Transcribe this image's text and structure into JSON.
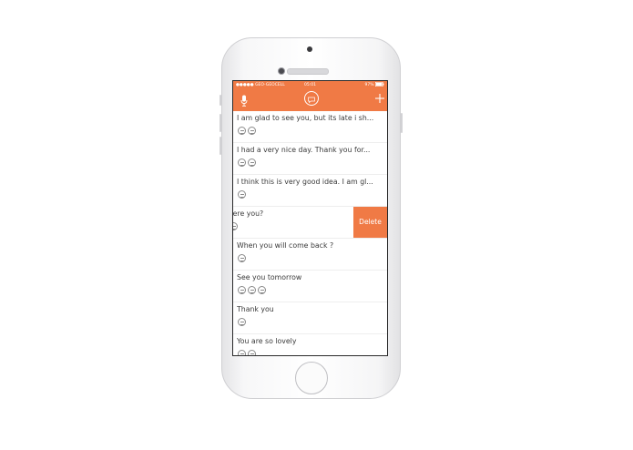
{
  "status_bar": {
    "carrier": "●●●●● GEO-GEOCELL",
    "time": "05:01",
    "battery": "97%"
  },
  "nav": {
    "left_icon": "microphone-icon",
    "center_icon": "app-logo-icon",
    "right_icon": "plus-icon"
  },
  "colors": {
    "accent": "#f07a45",
    "text": "#3a3a3a",
    "icon": "#8a8a8a"
  },
  "messages": [
    {
      "text": "I am glad to see you, but its late i sh...",
      "icon_count": 2
    },
    {
      "text": "I had a very nice day. Thank you for...",
      "icon_count": 2
    },
    {
      "text": "I think this is very good idea. I am gl...",
      "icon_count": 1
    },
    {
      "text": "vere you?",
      "icon_count": 1,
      "swiped": true,
      "action_label": "Delete"
    },
    {
      "text": "When you will come back ?",
      "icon_count": 1
    },
    {
      "text": "See you tomorrow",
      "icon_count": 3
    },
    {
      "text": "Thank you",
      "icon_count": 1
    },
    {
      "text": "You are so lovely",
      "icon_count": 2
    }
  ]
}
